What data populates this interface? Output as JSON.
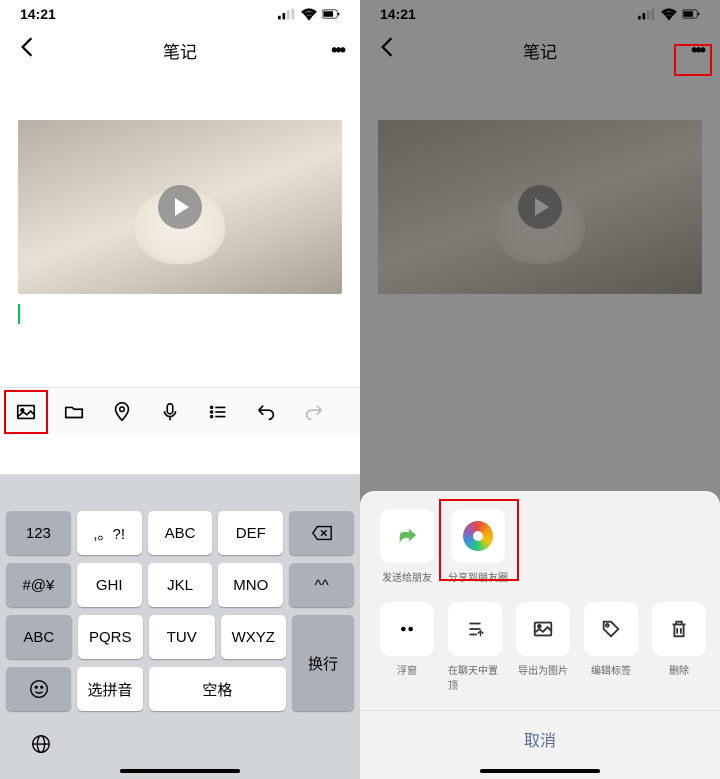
{
  "status": {
    "time": "14:21"
  },
  "nav": {
    "title": "笔记"
  },
  "toolbar": {
    "items": [
      "image",
      "folder",
      "location",
      "mic",
      "list",
      "undo",
      "redo"
    ]
  },
  "keyboard": {
    "row1": [
      "123",
      ",。?!",
      "ABC",
      "DEF"
    ],
    "backspace": "⌫",
    "row2": [
      "#@¥",
      "GHI",
      "JKL",
      "MNO",
      "^^"
    ],
    "row3": [
      "ABC",
      "PQRS",
      "TUV",
      "WXYZ"
    ],
    "linebreak": "换行",
    "row4_emoji": "☺",
    "row4_pinyin": "选拼音",
    "row4_space": "空格"
  },
  "share_sheet": {
    "row1": [
      {
        "icon": "forward",
        "label": "发送给朋友"
      },
      {
        "icon": "moments",
        "label": "分享到朋友圈"
      }
    ],
    "row2": [
      {
        "icon": "dots",
        "label": "浮窗"
      },
      {
        "icon": "pin",
        "label": "在聊天中置顶"
      },
      {
        "icon": "image",
        "label": "导出为图片"
      },
      {
        "icon": "tag",
        "label": "编辑标签"
      },
      {
        "icon": "trash",
        "label": "删除"
      }
    ],
    "cancel": "取消"
  }
}
